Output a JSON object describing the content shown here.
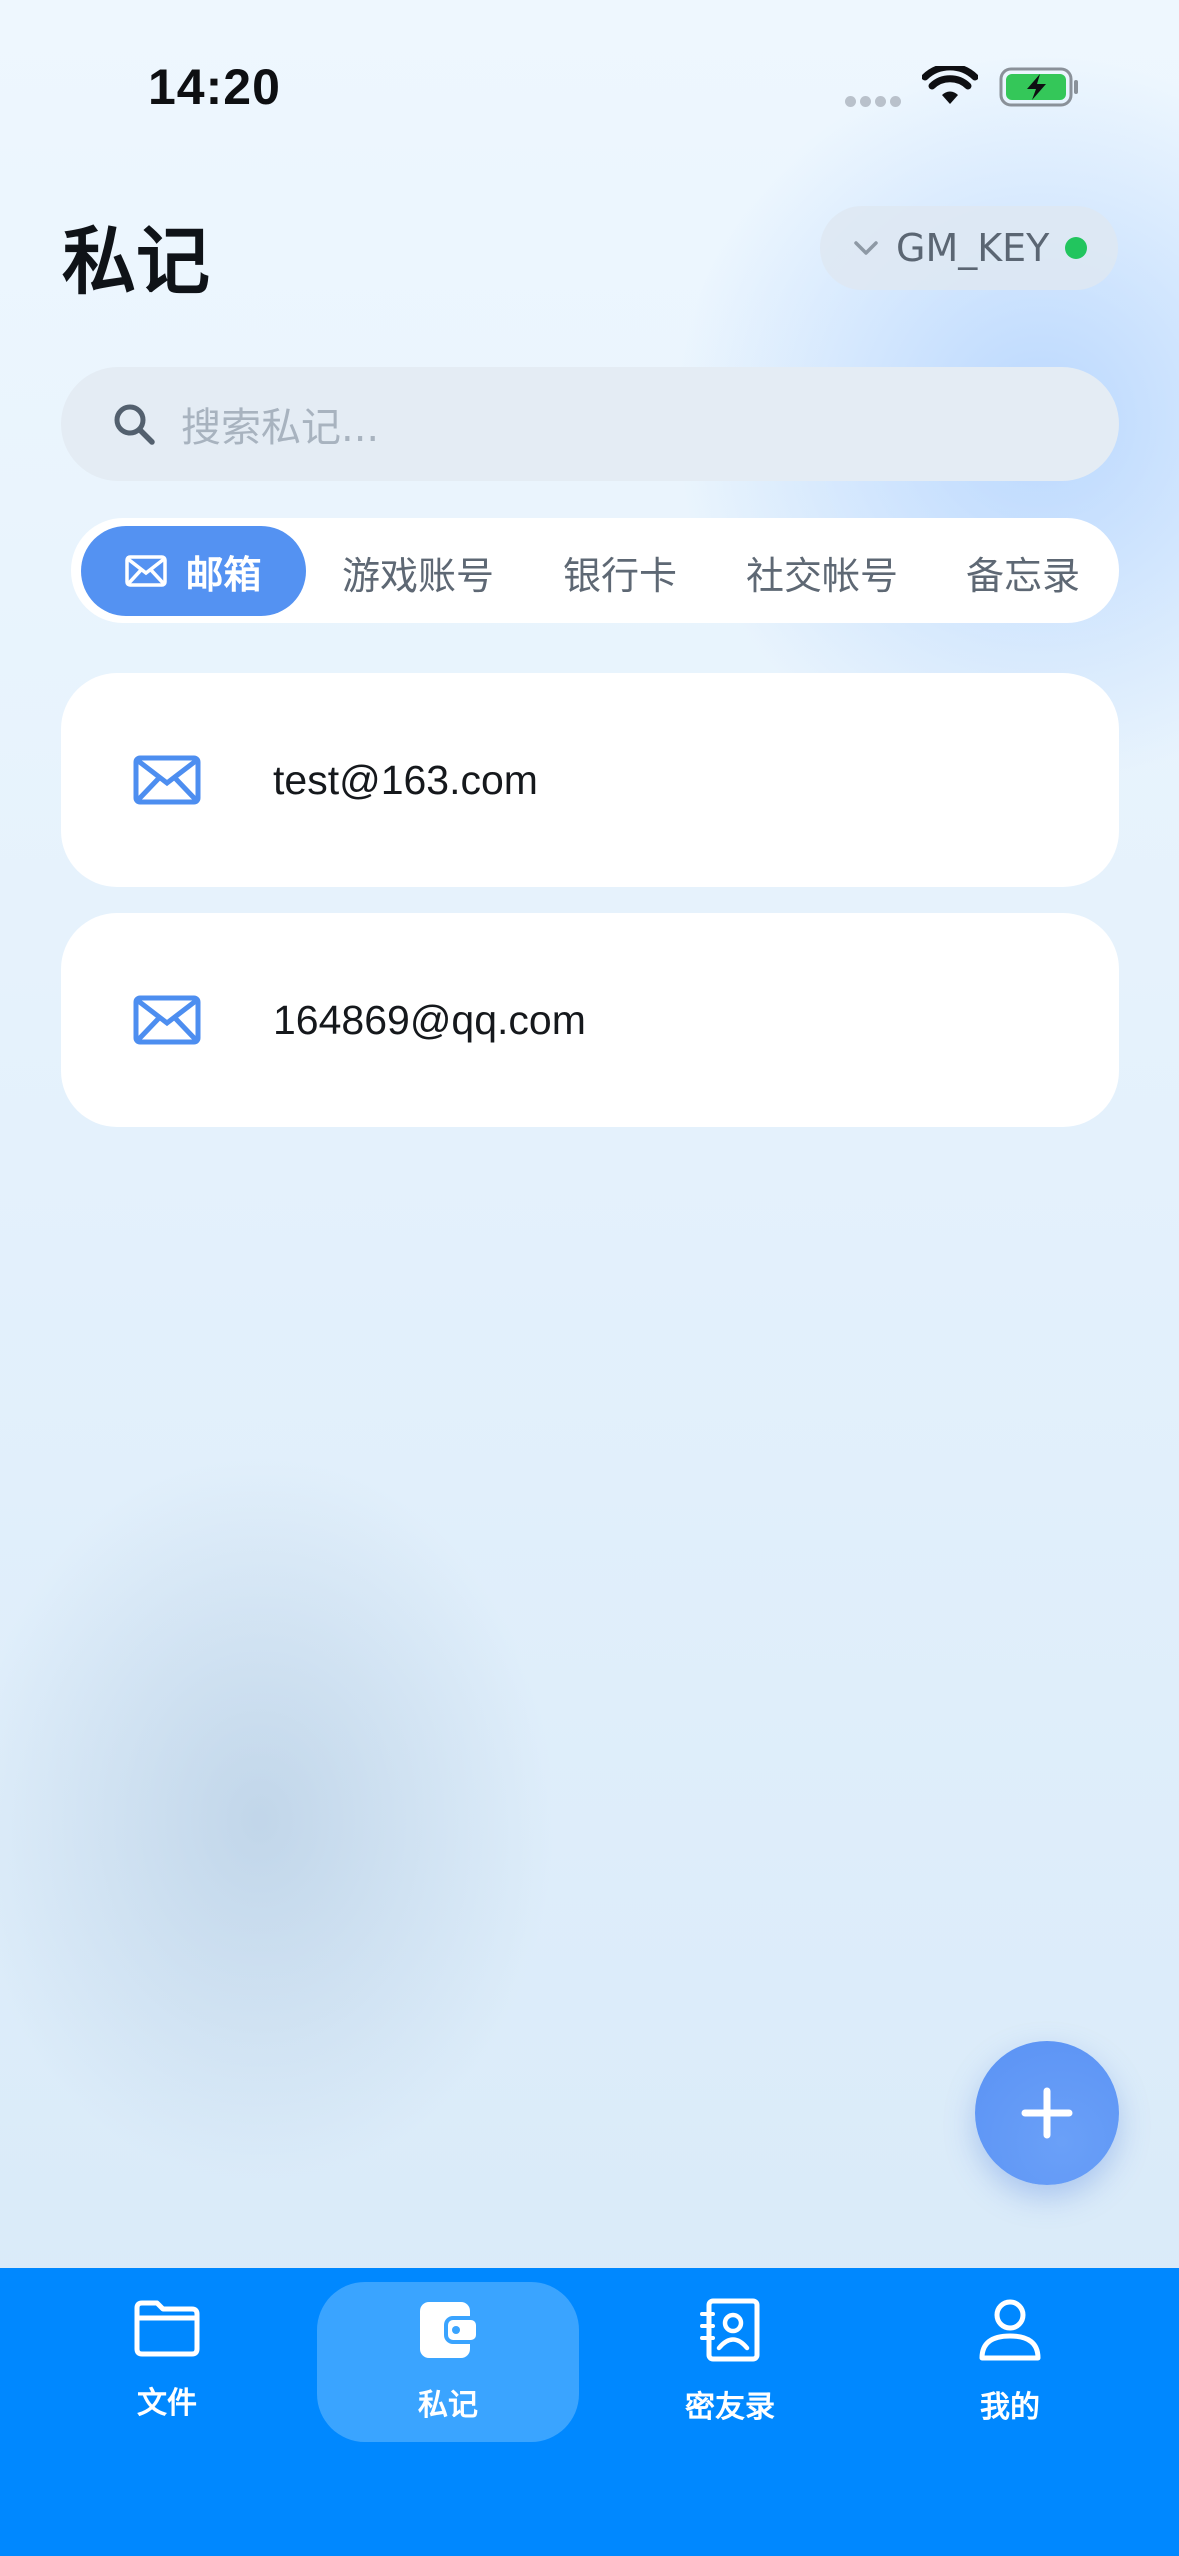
{
  "status_bar": {
    "time": "14:20",
    "battery": "charging"
  },
  "header": {
    "title": "私记",
    "key_selector": {
      "label": "GM_KEY",
      "status_color": "#22c55e",
      "icon": "chevron-down-icon"
    }
  },
  "search": {
    "placeholder": "搜索私记...",
    "icon": "search-icon"
  },
  "categories": {
    "active": {
      "label": "邮箱",
      "icon": "mail-icon"
    },
    "items": [
      {
        "label": "游戏账号"
      },
      {
        "label": "银行卡"
      },
      {
        "label": "社交帐号"
      },
      {
        "label": "备忘录"
      }
    ]
  },
  "entries": [
    {
      "icon": "mail-icon",
      "text": "test@163.com"
    },
    {
      "icon": "mail-icon",
      "text": "164869@qq.com"
    }
  ],
  "fab": {
    "icon": "plus-icon"
  },
  "bottom_nav": {
    "active_index": 1,
    "items": [
      {
        "label": "文件",
        "icon": "folder-icon"
      },
      {
        "label": "私记",
        "icon": "wallet-icon"
      },
      {
        "label": "密友录",
        "icon": "contacts-book-icon"
      },
      {
        "label": "我的",
        "icon": "user-icon"
      }
    ]
  },
  "colors": {
    "accent": "#5492f2",
    "nav_background": "#0088ff",
    "nav_active": "#3aa4ff",
    "status_dot": "#22c55e"
  }
}
